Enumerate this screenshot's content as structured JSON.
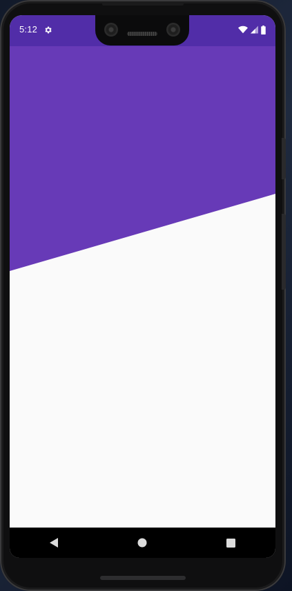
{
  "statusbar": {
    "time": "5:12",
    "settings_icon": "gear-icon",
    "icons": [
      "wifi-icon",
      "signal-icon",
      "battery-icon"
    ]
  },
  "colors": {
    "primary": "#673ab7",
    "status_bar": "#512da8",
    "background": "#fafafa",
    "nav_bar": "#000000",
    "status_text": "#ffffff"
  },
  "navbar": {
    "buttons": [
      {
        "name": "back",
        "icon": "triangle-left-icon"
      },
      {
        "name": "home",
        "icon": "circle-icon"
      },
      {
        "name": "recents",
        "icon": "square-icon"
      }
    ]
  }
}
